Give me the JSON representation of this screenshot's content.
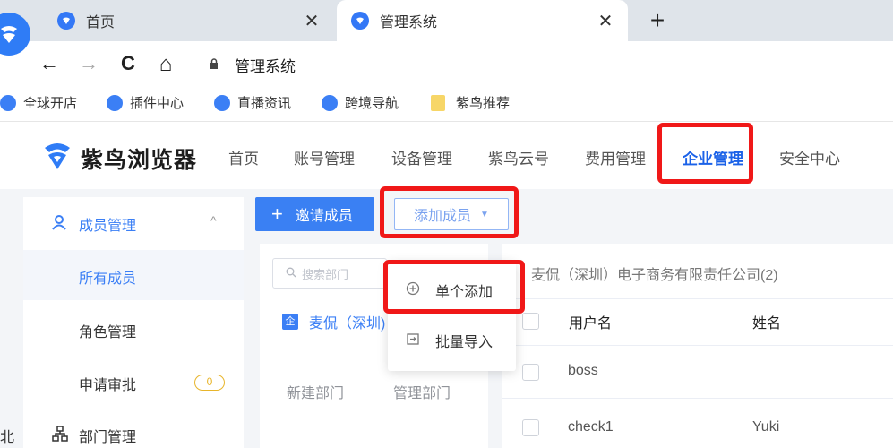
{
  "browser": {
    "tabs": [
      {
        "label": "首页",
        "active": false
      },
      {
        "label": "管理系统",
        "active": true
      }
    ],
    "close_symbol": "✕",
    "newtab_symbol": "+",
    "nav": {
      "back": "←",
      "forward": "→",
      "reload": "C",
      "home": "⌂"
    },
    "address": "管理系统",
    "bookmarks": [
      {
        "label": "全球开店",
        "icon": "browser-icon"
      },
      {
        "label": "插件中心",
        "icon": "browser-icon"
      },
      {
        "label": "直播资讯",
        "icon": "browser-icon"
      },
      {
        "label": "跨境导航",
        "icon": "browser-icon"
      },
      {
        "label": "紫鸟推荐",
        "icon": "folder-icon"
      }
    ]
  },
  "app": {
    "brand": "紫鸟浏览器",
    "nav": [
      "首页",
      "账号管理",
      "设备管理",
      "紫鸟云号",
      "费用管理",
      "企业管理",
      "安全中心"
    ],
    "active_nav": "企业管理",
    "sidebar": {
      "member_group": "成员管理",
      "items": [
        "所有成员",
        "角色管理",
        "申请审批"
      ],
      "approval_badge": "0",
      "dept_group": "部门管理"
    },
    "toolbar": {
      "invite_label": "邀请成员",
      "add_label": "添加成员"
    },
    "dropdown": {
      "single_add": "单个添加",
      "batch_import": "批量导入"
    },
    "dept_panel": {
      "search_placeholder": "搜索部门",
      "dept_badge": "企",
      "dept_name": "麦侃（深圳)",
      "new_dept": "新建部门",
      "manage_dept": "管理部门"
    },
    "table": {
      "company": "麦侃（深圳）电子商务有限责任公司(2)",
      "headers": [
        "用户名",
        "姓名"
      ],
      "rows": [
        {
          "username": "boss",
          "name": ""
        },
        {
          "username": "check1",
          "name": "Yuki"
        }
      ]
    },
    "left_edge_text": "北"
  },
  "colors": {
    "primary": "#3a80f3",
    "highlight_red": "#f01818",
    "badge_yellow": "#e8b52b"
  }
}
